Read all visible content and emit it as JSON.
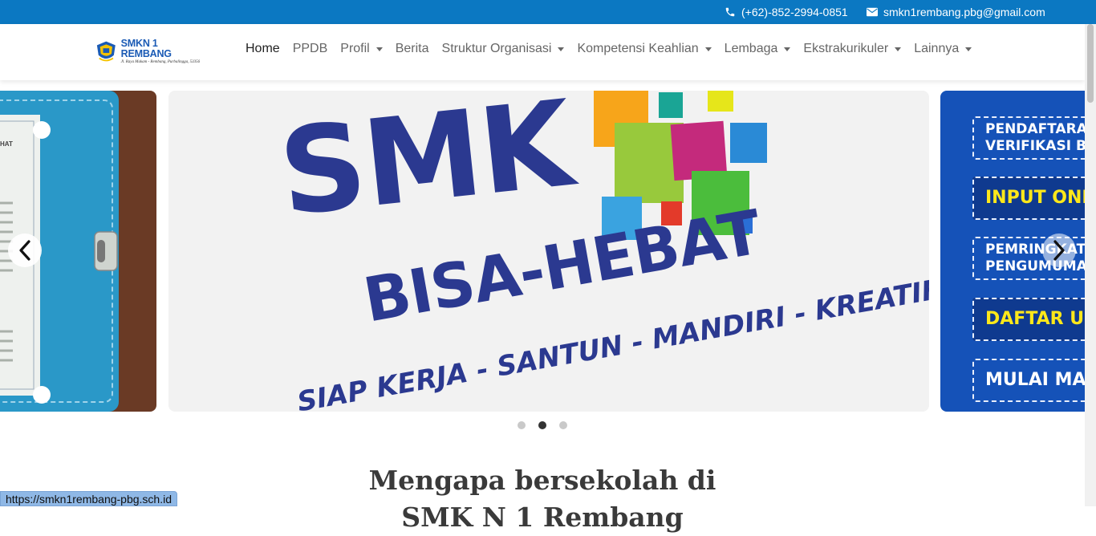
{
  "topbar": {
    "phone": "(+62)-852-2994-0851",
    "email": "smkn1rembang.pbg@gmail.com",
    "phone_icon": "phone-icon",
    "email_icon": "envelope-icon"
  },
  "brand": {
    "name": "SMKN 1 REMBANG",
    "address": "Jl. Raya Makam - Rembang, Purbalingga, 53356"
  },
  "nav": [
    {
      "label": "Home",
      "active": true,
      "dropdown": false
    },
    {
      "label": "PPDB",
      "dropdown": false
    },
    {
      "label": "Profil",
      "dropdown": true
    },
    {
      "label": "Berita",
      "dropdown": false
    },
    {
      "label": "Struktur Organisasi",
      "dropdown": true
    },
    {
      "label": "Kompetensi Keahlian",
      "dropdown": true
    },
    {
      "label": "Lembaga",
      "dropdown": true
    },
    {
      "label": "Ekstrakurikuler",
      "dropdown": true
    },
    {
      "label": "Lainnya",
      "dropdown": true
    }
  ],
  "carousel": {
    "left_slide_text": "HAT",
    "center_slide": {
      "line1": "SMK",
      "line2": "BISA-HEBAT",
      "line3": "SIAP KERJA - SANTUN - MANDIRI - KREATIF"
    },
    "right_slide_items": [
      "PENDAFTARA",
      "VERIFIKASI B",
      "INPUT ONL",
      "PEMRINGKAT",
      "PENGUMUMA",
      "DAFTAR U",
      "MULAI MA"
    ],
    "dots": 3,
    "active_dot": 1
  },
  "section": {
    "heading_line1": "Mengapa bersekolah di",
    "heading_line2": "SMK N 1 Rembang"
  },
  "status_url": "https://smkn1rembang-pbg.sch.id",
  "colors": {
    "topbar": "#0b78c2",
    "brand_blue": "#2b3990",
    "right_slide_blue": "#1552b8"
  }
}
